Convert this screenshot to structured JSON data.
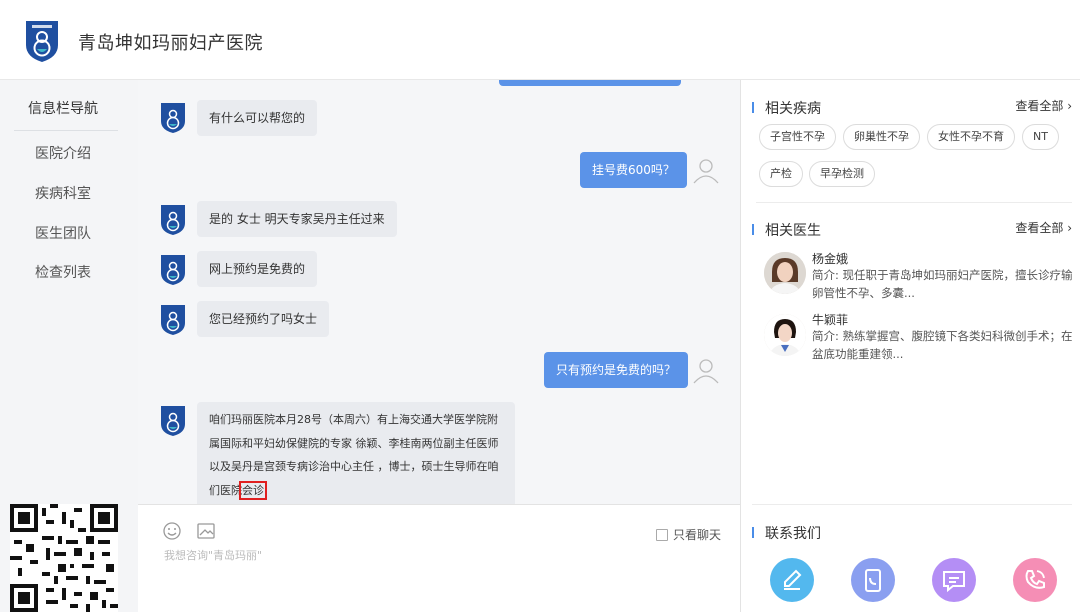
{
  "header": {
    "hospital_name": "青岛坤如玛丽妇产医院"
  },
  "nav": {
    "title": "信息栏导航",
    "items": [
      "医院介绍",
      "疾病科室",
      "医生团队",
      "检查列表"
    ]
  },
  "chat": {
    "messages": [
      {
        "from": "bot",
        "text": "有什么可以帮您的"
      },
      {
        "from": "user",
        "text": "挂号费600吗？"
      },
      {
        "from": "bot",
        "text": "是的 女士 明天专家吴丹主任过来"
      },
      {
        "from": "bot",
        "text": "网上预约是免费的"
      },
      {
        "from": "bot",
        "text": "您已经预约了吗女士"
      },
      {
        "from": "user",
        "text": "只有预约是免费的吗？"
      }
    ],
    "long_message": {
      "text_main": "咱们玛丽医院本月28号（本周六）有上海交通大学医学院附属国际和平妇幼保健院的专家 徐颖、李桂南两位副主任医师以及吴丹是宫颈专病诊治中心主任 ，博士，硕士生导师在咱们医院",
      "text_highlight": "会诊"
    }
  },
  "input": {
    "placeholder": "我想咨询\"青岛玛丽\"",
    "only_chat_label": "只看聊天"
  },
  "right": {
    "diseases": {
      "title": "相关疾病",
      "view_all": "查看全部 ›",
      "tags": [
        "子宫性不孕",
        "卵巢性不孕",
        "女性不孕不育",
        "NT",
        "产检",
        "早孕检测"
      ]
    },
    "doctors": {
      "title": "相关医生",
      "view_all": "查看全部 ›",
      "list": [
        {
          "name": "杨金娥",
          "intro": "简介: 现任职于青岛坤如玛丽妇产医院，擅长诊疗输卵管性不孕、多囊..."
        },
        {
          "name": "牛颖菲",
          "intro": "简介: 熟练掌握宫、腹腔镜下各类妇科微创手术；在盆底功能重建领..."
        }
      ]
    },
    "contact": {
      "title": "联系我们",
      "button_colors": [
        "#53b8ee",
        "#8a9ff0",
        "#b48ef5",
        "#f58eb5"
      ],
      "button_icons": [
        "pencil-icon",
        "phone-card-icon",
        "message-icon",
        "call-icon"
      ]
    }
  }
}
